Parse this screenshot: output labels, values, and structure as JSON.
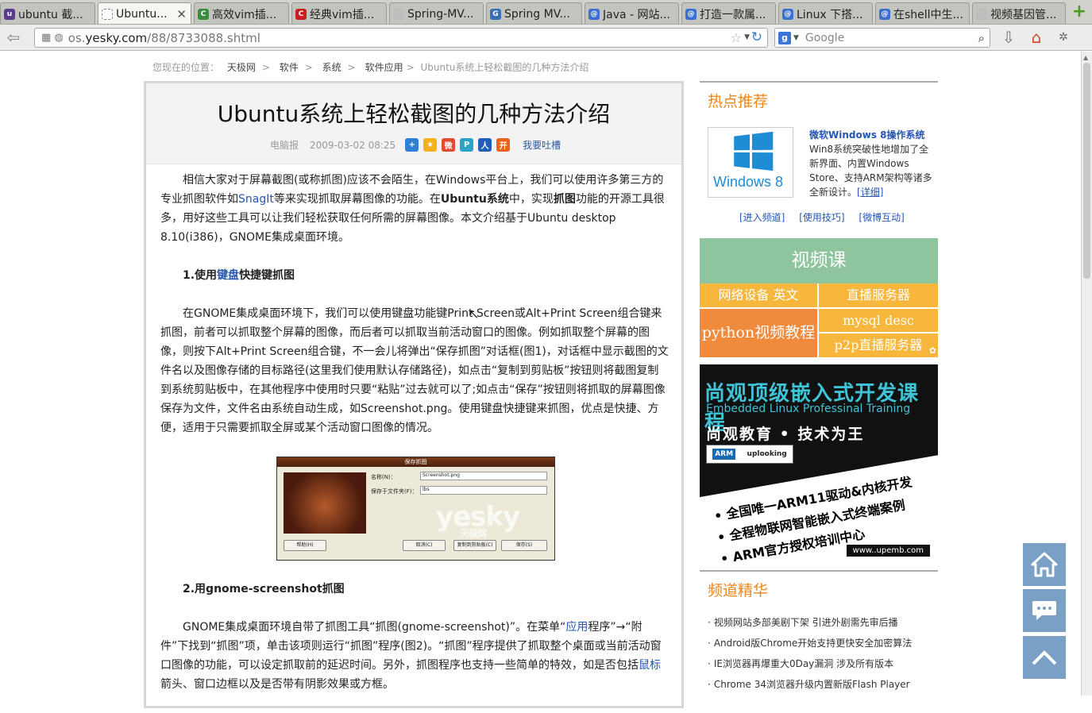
{
  "tabs": [
    {
      "title": "ubuntu 截...",
      "fav_color": "#5a3b8c",
      "fav": "u"
    },
    {
      "title": "Ubuntu...",
      "fav_color": "#ffffff",
      "fav": "",
      "active": true
    },
    {
      "title": "高效vim插...",
      "fav_color": "#3d8c3d",
      "fav": "C"
    },
    {
      "title": "经典vim插...",
      "fav_color": "#c81e1e",
      "fav": "C"
    },
    {
      "title": "Spring-MV...",
      "fav_color": "#bdbdbd",
      "fav": ""
    },
    {
      "title": "Spring MV...",
      "fav_color": "#3a6fb5",
      "fav": "G"
    },
    {
      "title": "Java - 网站...",
      "fav_color": "#3b6fd0",
      "fav": "@"
    },
    {
      "title": "打造一款属...",
      "fav_color": "#3b6fd0",
      "fav": "@"
    },
    {
      "title": "Linux 下搭...",
      "fav_color": "#3b6fd0",
      "fav": "@"
    },
    {
      "title": "在shell中生...",
      "fav_color": "#3b6fd0",
      "fav": "@"
    },
    {
      "title": "视频基因管...",
      "fav_color": "#bdbdbd",
      "fav": ""
    }
  ],
  "nav": {
    "url_prefix": "os.",
    "url_domain": "yesky.com",
    "url_path": "/88/8733088.shtml",
    "search_placeholder": "Google"
  },
  "breadcrumb": {
    "label": "您现在的位置：",
    "items": [
      "天极网",
      "软件",
      "系统",
      "软件应用"
    ],
    "current": "Ubuntu系统上轻松截图的几种方法介绍"
  },
  "article": {
    "title": "Ubuntu系统上轻松截图的几种方法介绍",
    "source": "电脑报",
    "date": "2009-03-02 08:25",
    "comment": "我要吐槽",
    "p1": [
      "相信大家对于屏幕截图(或称抓图)应该不会陌生，在Windows平台上，我们可以使用许多第三方的专业抓图软件如",
      "SnagIt",
      "等来实现抓取屏幕图像的功能。在",
      "Ubuntu系统",
      "中，实现",
      "抓图",
      "功能的开源工具很多，用好这些工具可以让我们轻松获取任何所需的屏幕图像。本文介绍基于Ubuntu desktop 8.10(i386)，GNOME集成桌面环境。"
    ],
    "h1": [
      "1.使用",
      "键盘",
      "快捷键抓图"
    ],
    "p2": "在GNOME集成桌面环境下，我们可以使用键盘功能键Print Screen或Alt+Print Screen组合键来抓图，前者可以抓取整个屏幕的图像，而后者可以抓取当前活动窗口的图像。例如抓取整个屏幕的图像，则按下Alt+Print Screen组合键，不一会儿将弹出“保存抓图”对话框(图1)，对话框中显示截图的文件名以及图像存储的目标路径(这里我们使用默认存储路径)，如点击“复制到剪贴板”按钮则将截图复制到系统剪贴板中，在其他程序中使用时只要“粘贴”过去就可以了;如点击“保存”按钮则将抓取的屏幕图像保存为文件，文件名由系统自动生成，如Screenshot.png。使用键盘快捷键来抓图，优点是快捷、方便，适用于只需要抓取全屏或某个活动窗口图像的情况。",
    "figure": {
      "title": "保存抓图",
      "name_label": "名称(N)：",
      "name_value": "Screenshot.png",
      "folder_label": "保存于文件夹(F)：",
      "folder_value": "lbs",
      "help": "帮助(H)",
      "cancel": "取消(C)",
      "copy": "复制到剪贴板(C)",
      "save": "保存(S)",
      "watermark": "yesky",
      "watermark_sub": "天极网"
    },
    "h2": "2.用gnome-screenshot抓图",
    "p3": [
      "GNOME集成桌面环境自带了抓图工具“抓图(gnome-screenshot)”。在菜单“",
      "应用",
      "程序”→“附件”下找到“抓图”项，单击该项则运行“抓图”程序(图2)。“抓图”程序提供了抓取整个桌面或当前活动窗口图像的功能，可以设定抓取前的延迟时间。另外，抓图程序也支持一些简单的特效，如是否包括",
      "鼠标",
      "箭头、窗口边框以及是否带有阴影效果或方框。"
    ]
  },
  "side": {
    "hot_title": "热点推荐",
    "hot_logo_text": "Windows 8",
    "hot_headline": "微软Windows 8操作系统",
    "hot_desc": "Win8系统突破性地增加了全新界面、内置Windows Store、支持ARM架构等诸多全新设计。",
    "hot_more": "[详细]",
    "hot_links": [
      "[进入频道]",
      "[使用技巧]",
      "[微博互动]"
    ],
    "video_title": "视频课",
    "video_cells": [
      "网络设备 英文",
      "直播服务器",
      "python视频教程",
      "mysql desc",
      "p2p直播服务器"
    ],
    "ad": {
      "l1": "尚观顶级嵌入式开发课程",
      "l2": "Embedded Linux Professinal Training",
      "l3": "尚观教育 • 技术为王",
      "logo1": "ARM",
      "logo2": "uplooking",
      "b1": "• 全国唯一ARM11驱动&内核开发",
      "b2": "• 全程物联网智能嵌入式终端案例",
      "b3": "• ARM官方授权培训中心",
      "url": "www..upemb.com"
    },
    "chan_title": "频道精华",
    "chan_items": [
      "视频网站多部美剧下架 引进外剧需先审后播",
      "Android版Chrome开始支持更快安全加密算法",
      "IE浏览器再爆重大0Day漏洞 涉及所有版本",
      "Chrome 34浏览器升级内置新版Flash Player"
    ]
  },
  "colors": {
    "accent_orange": "#f08519",
    "link_blue": "#2456b4",
    "video_green": "#8fc59e",
    "video_orange": "#f6b73c",
    "python_orange": "#f08a3c",
    "float_btn": "#7aa0c6"
  }
}
